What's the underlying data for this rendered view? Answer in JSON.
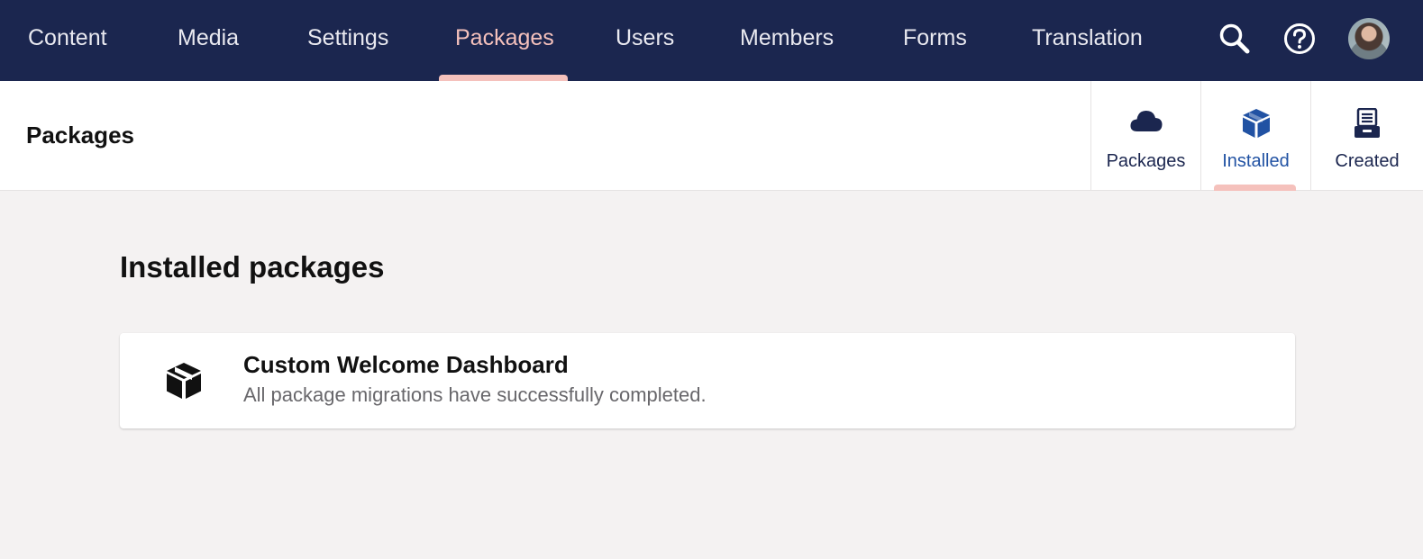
{
  "nav": {
    "items": [
      {
        "label": "Content"
      },
      {
        "label": "Media"
      },
      {
        "label": "Settings"
      },
      {
        "label": "Packages"
      },
      {
        "label": "Users"
      },
      {
        "label": "Members"
      },
      {
        "label": "Forms"
      },
      {
        "label": "Translation"
      }
    ],
    "active": "Packages",
    "icons": [
      "search-icon",
      "help-icon",
      "avatar"
    ]
  },
  "header": {
    "title": "Packages",
    "tabs": [
      {
        "label": "Packages",
        "icon": "cloud-icon"
      },
      {
        "label": "Installed",
        "icon": "package-icon"
      },
      {
        "label": "Created",
        "icon": "archive-icon"
      }
    ],
    "active_tab": "Installed"
  },
  "main": {
    "title": "Installed packages",
    "packages": [
      {
        "name": "Custom Welcome Dashboard",
        "status": "All package migrations have successfully completed.",
        "icon": "package-icon"
      }
    ]
  },
  "colors": {
    "topbar": "#1b264f",
    "accent": "#f5c1bc",
    "active_tab_text": "#2152a3",
    "background": "#f4f2f2"
  }
}
